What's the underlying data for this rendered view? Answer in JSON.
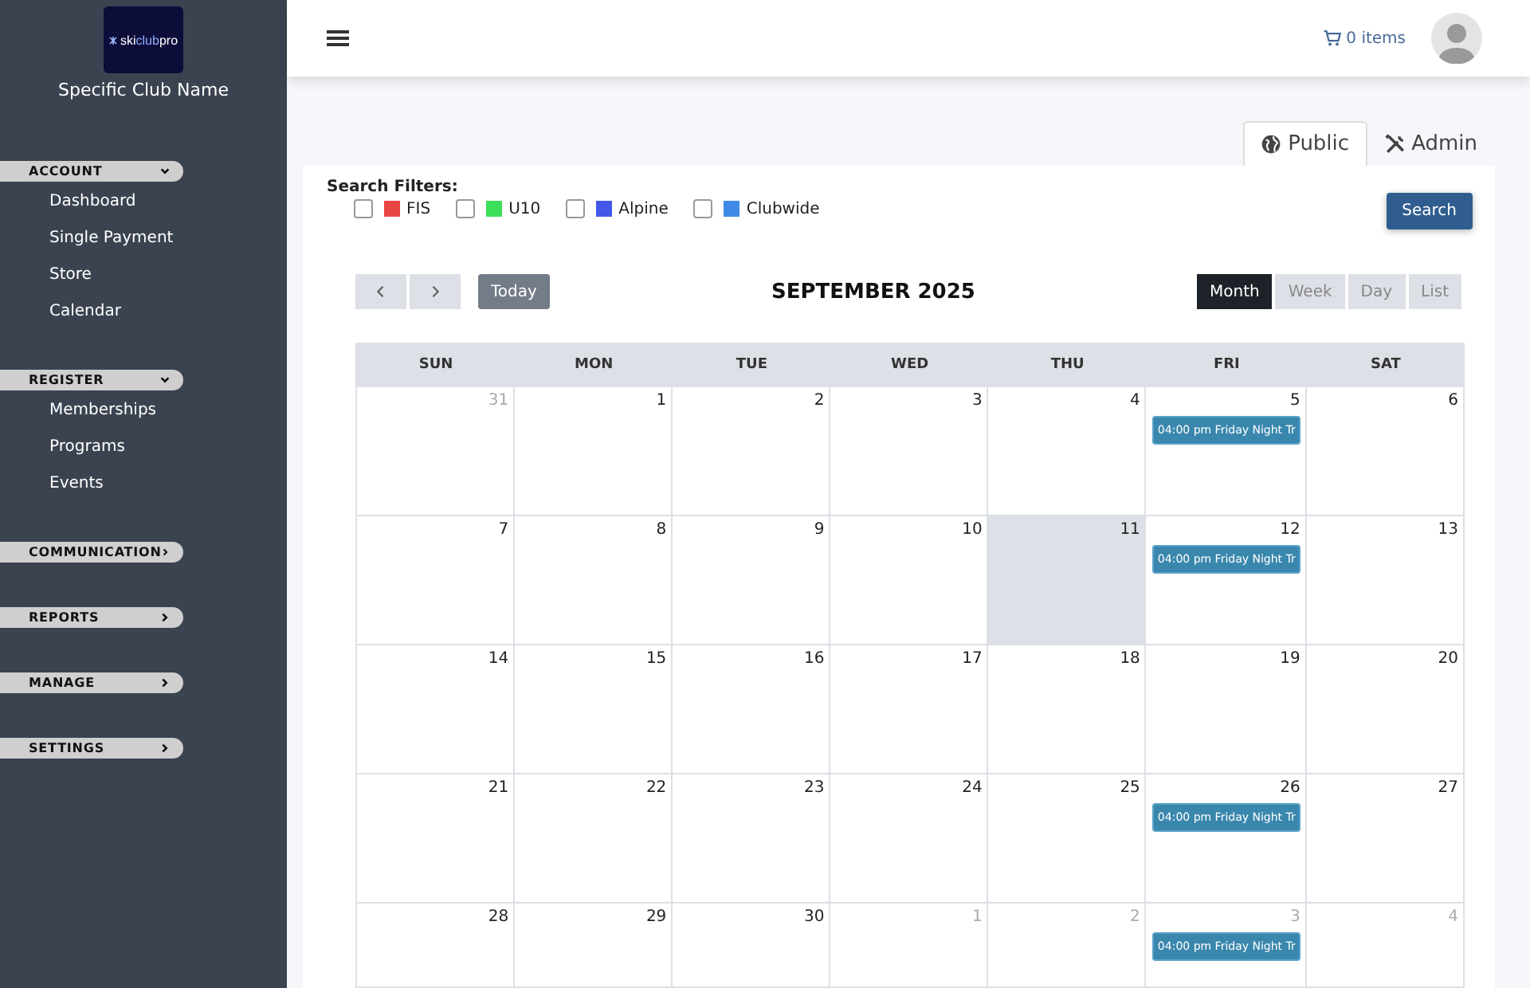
{
  "sidebar": {
    "logo": {
      "parts": [
        "ski",
        "club",
        "pro"
      ]
    },
    "club_name": "Specific Club Name",
    "sections": [
      {
        "label": "ACCOUNT",
        "expanded": true,
        "items": [
          "Dashboard",
          "Single Payment",
          "Store",
          "Calendar"
        ]
      },
      {
        "label": "REGISTER",
        "expanded": true,
        "items": [
          "Memberships",
          "Programs",
          "Events"
        ]
      },
      {
        "label": "COMMUNICATION",
        "expanded": false
      },
      {
        "label": "REPORTS",
        "expanded": false
      },
      {
        "label": "MANAGE",
        "expanded": false
      },
      {
        "label": "SETTINGS",
        "expanded": false
      }
    ]
  },
  "header": {
    "cart": "0 items"
  },
  "tabs": [
    {
      "label": "Public",
      "selected": true,
      "kind": "globe"
    },
    {
      "label": "Admin",
      "selected": false,
      "kind": "tools"
    }
  ],
  "filters": {
    "title": "Search Filters:",
    "items": [
      {
        "label": "FIS",
        "checked": false,
        "color": "#e84545"
      },
      {
        "label": "U10",
        "checked": false,
        "color": "#3dde5a"
      },
      {
        "label": "Alpine",
        "checked": false,
        "color": "#4357e8"
      },
      {
        "label": "Clubwide",
        "checked": false,
        "color": "#3f8ae6"
      }
    ],
    "button": "Search"
  },
  "calendar": {
    "title": "SEPTEMBER 2025",
    "today_button": "Today",
    "views": [
      {
        "label": "Month",
        "selected": true
      },
      {
        "label": "Week",
        "selected": false
      },
      {
        "label": "Day",
        "selected": false
      },
      {
        "label": "List",
        "selected": false
      }
    ],
    "weekdays": [
      "SUN",
      "MON",
      "TUE",
      "WED",
      "THU",
      "FRI",
      "SAT"
    ],
    "weeks": [
      [
        {
          "day": "31",
          "muted": true,
          "today": false
        },
        {
          "day": "1",
          "muted": false,
          "today": false
        },
        {
          "day": "2",
          "muted": false,
          "today": false
        },
        {
          "day": "3",
          "muted": false,
          "today": false
        },
        {
          "day": "4",
          "muted": false,
          "today": false
        },
        {
          "day": "5",
          "muted": false,
          "today": false,
          "events": [
            "04:00 pm Friday Night Tr"
          ]
        },
        {
          "day": "6",
          "muted": false,
          "today": false
        }
      ],
      [
        {
          "day": "7",
          "muted": false,
          "today": false
        },
        {
          "day": "8",
          "muted": false,
          "today": false
        },
        {
          "day": "9",
          "muted": false,
          "today": false
        },
        {
          "day": "10",
          "muted": false,
          "today": false
        },
        {
          "day": "11",
          "muted": false,
          "today": true
        },
        {
          "day": "12",
          "muted": false,
          "today": false,
          "events": [
            "04:00 pm Friday Night Tr"
          ]
        },
        {
          "day": "13",
          "muted": false,
          "today": false
        }
      ],
      [
        {
          "day": "14",
          "muted": false,
          "today": false
        },
        {
          "day": "15",
          "muted": false,
          "today": false
        },
        {
          "day": "16",
          "muted": false,
          "today": false
        },
        {
          "day": "17",
          "muted": false,
          "today": false
        },
        {
          "day": "18",
          "muted": false,
          "today": false
        },
        {
          "day": "19",
          "muted": false,
          "today": false
        },
        {
          "day": "20",
          "muted": false,
          "today": false
        }
      ],
      [
        {
          "day": "21",
          "muted": false,
          "today": false
        },
        {
          "day": "22",
          "muted": false,
          "today": false
        },
        {
          "day": "23",
          "muted": false,
          "today": false
        },
        {
          "day": "24",
          "muted": false,
          "today": false
        },
        {
          "day": "25",
          "muted": false,
          "today": false
        },
        {
          "day": "26",
          "muted": false,
          "today": false,
          "events": [
            "04:00 pm Friday Night Tr"
          ]
        },
        {
          "day": "27",
          "muted": false,
          "today": false
        }
      ],
      [
        {
          "day": "28",
          "muted": false,
          "today": false
        },
        {
          "day": "29",
          "muted": false,
          "today": false
        },
        {
          "day": "30",
          "muted": false,
          "today": false
        },
        {
          "day": "1",
          "muted": true,
          "today": false
        },
        {
          "day": "2",
          "muted": true,
          "today": false
        },
        {
          "day": "3",
          "muted": true,
          "today": false,
          "events": [
            "04:00 pm Friday Night Tr"
          ]
        },
        {
          "day": "4",
          "muted": true,
          "today": false
        }
      ]
    ]
  }
}
